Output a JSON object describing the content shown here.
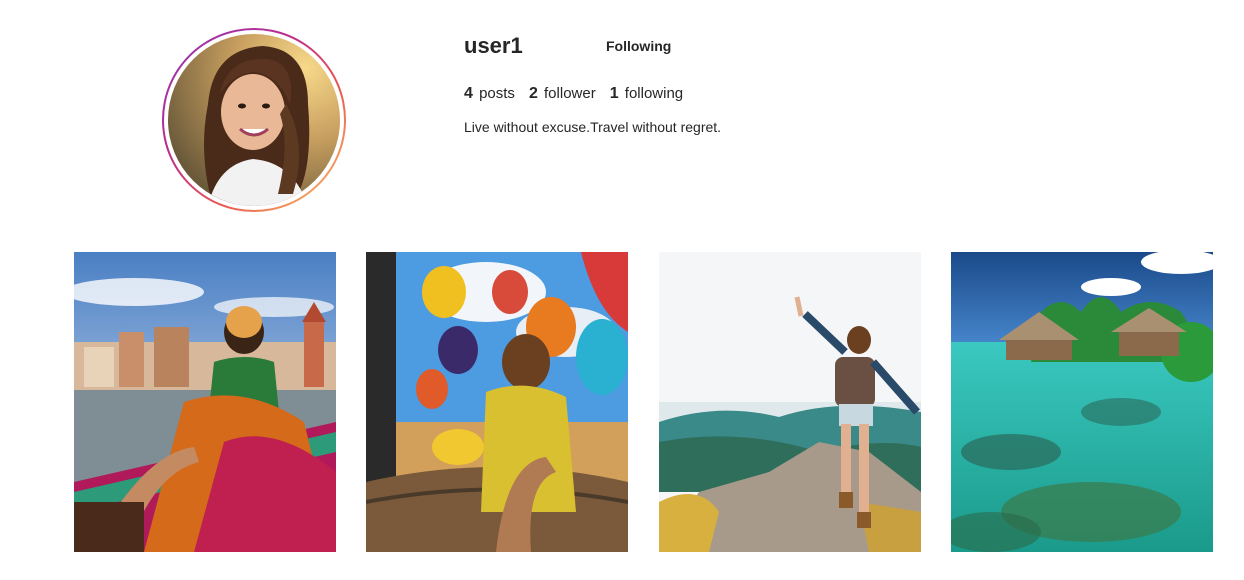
{
  "profile": {
    "username": "user1",
    "follow_button_label": "Following",
    "bio": "Live without excuse.Travel without regret.",
    "stats": {
      "posts_count": "4",
      "posts_label": "posts",
      "followers_count": "2",
      "followers_label": "follower",
      "following_count": "1",
      "following_label": "following"
    },
    "avatar_ring_colors": [
      "#8a3ab9",
      "#bc2a8d",
      "#e95950",
      "#fccc63"
    ]
  },
  "posts": [
    {
      "subject": "woman in sari on boat at riverside city"
    },
    {
      "subject": "hot air balloons over desert"
    },
    {
      "subject": "hiker with backpack on mountain top"
    },
    {
      "subject": "overwater bungalows in turquoise lagoon"
    }
  ]
}
